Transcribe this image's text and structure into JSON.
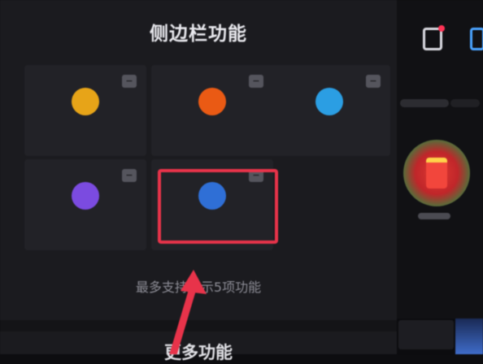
{
  "panel": {
    "title": "侧边栏功能",
    "hint": "最多支持展示5项功能",
    "more_title": "更多功能"
  },
  "tiles": [
    {
      "label": "",
      "color": "#e7a418",
      "badge": "−"
    },
    {
      "label": "",
      "color": "#ea5a14",
      "badge": "−"
    },
    {
      "label": "",
      "color": "#2b9ee3",
      "badge": "−"
    },
    {
      "label": "",
      "color": "#7b4be0",
      "badge": "−"
    },
    {
      "label": "",
      "color": "#2f6fd6",
      "badge": "−"
    }
  ],
  "colors": {
    "highlight": "#e8334a",
    "arrow": "#e8334a",
    "background": "#1b1b1f"
  },
  "side": {
    "icons": [
      "messages-icon",
      "phone-icon"
    ]
  }
}
